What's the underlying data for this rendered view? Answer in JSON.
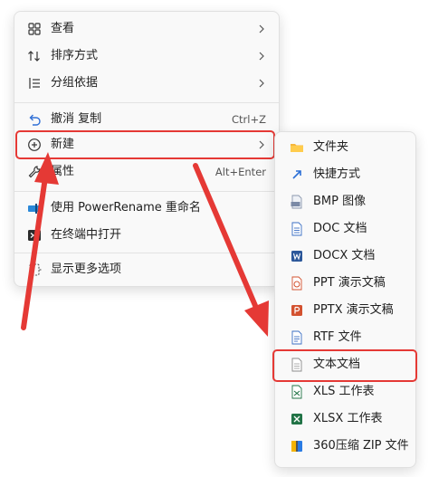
{
  "context_menu": {
    "items": [
      {
        "label": "查看",
        "icon": "grid-view-icon"
      },
      {
        "label": "排序方式",
        "icon": "sort-icon"
      },
      {
        "label": "分组依据",
        "icon": "group-by-icon"
      },
      {
        "label": "撤消 复制",
        "shortcut": "Ctrl+Z",
        "icon": "undo-icon"
      },
      {
        "label": "新建",
        "icon": "new-plus-icon"
      },
      {
        "label": "属性",
        "shortcut": "Alt+Enter",
        "icon": "wrench-icon"
      },
      {
        "label": "使用 PowerRename 重命名",
        "icon": "powerrename-icon"
      },
      {
        "label": "在终端中打开",
        "icon": "terminal-icon"
      },
      {
        "label": "显示更多选项",
        "icon": "more-options-icon"
      }
    ]
  },
  "new_submenu": {
    "items": [
      {
        "label": "文件夹",
        "icon": "folder-icon"
      },
      {
        "label": "快捷方式",
        "icon": "shortcut-icon"
      },
      {
        "label": "BMP 图像",
        "icon": "bmp-icon"
      },
      {
        "label": "DOC 文档",
        "icon": "doc-icon"
      },
      {
        "label": "DOCX 文档",
        "icon": "docx-icon"
      },
      {
        "label": "PPT 演示文稿",
        "icon": "ppt-icon"
      },
      {
        "label": "PPTX 演示文稿",
        "icon": "pptx-icon"
      },
      {
        "label": "RTF 文件",
        "icon": "rtf-icon"
      },
      {
        "label": "文本文档",
        "icon": "text-document-icon"
      },
      {
        "label": "XLS 工作表",
        "icon": "xls-icon"
      },
      {
        "label": "XLSX 工作表",
        "icon": "xlsx-icon"
      },
      {
        "label": "360压缩 ZIP 文件",
        "icon": "zip-icon"
      }
    ]
  },
  "annotation_color": "#e53935"
}
